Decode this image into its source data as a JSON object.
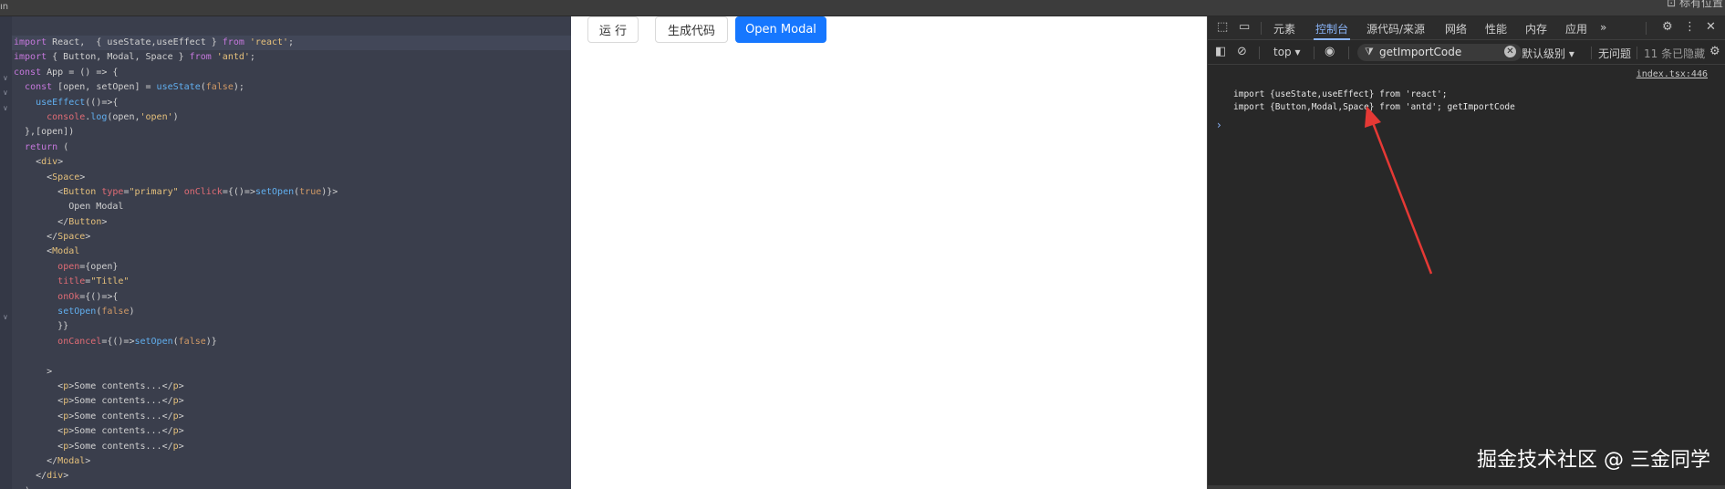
{
  "topbar": {
    "right_label": "⊡ 标有位置",
    "left_mark": "ın"
  },
  "editor": {
    "lines": [
      [
        [
          "kw",
          "import"
        ],
        [
          "plain",
          " React,  { useState,useEffect } "
        ],
        [
          "kw",
          "from"
        ],
        [
          "str",
          " 'react'"
        ],
        [
          "plain",
          ";"
        ]
      ],
      [
        [
          "kw",
          "import"
        ],
        [
          "plain",
          " { Button, Modal, Space } "
        ],
        [
          "kw",
          "from"
        ],
        [
          "str",
          " 'antd'"
        ],
        [
          "plain",
          ";"
        ]
      ],
      [
        [
          "kw",
          "const"
        ],
        [
          "plain",
          " App = () => {"
        ]
      ],
      [
        [
          "plain",
          "  "
        ],
        [
          "kw",
          "const"
        ],
        [
          "plain",
          " [open, setOpen] = "
        ],
        [
          "fn",
          "useState"
        ],
        [
          "plain",
          "("
        ],
        [
          "bool",
          "false"
        ],
        [
          "plain",
          ");"
        ]
      ],
      [
        [
          "plain",
          "    "
        ],
        [
          "fn",
          "useEffect"
        ],
        [
          "plain",
          "(()=>{"
        ]
      ],
      [
        [
          "plain",
          "      "
        ],
        [
          "attr",
          "console"
        ],
        [
          "plain",
          "."
        ],
        [
          "fn",
          "log"
        ],
        [
          "plain",
          "(open,"
        ],
        [
          "str",
          "'open'"
        ],
        [
          "plain",
          ")"
        ]
      ],
      [
        [
          "plain",
          "  },[open])"
        ]
      ],
      [
        [
          "plain",
          "  "
        ],
        [
          "kw",
          "return"
        ],
        [
          "plain",
          " ("
        ]
      ],
      [
        [
          "plain",
          "    <"
        ],
        [
          "tag",
          "div"
        ],
        [
          "plain",
          ">"
        ]
      ],
      [
        [
          "plain",
          "      <"
        ],
        [
          "tag",
          "Space"
        ],
        [
          "plain",
          ">"
        ]
      ],
      [
        [
          "plain",
          "        <"
        ],
        [
          "tag",
          "Button"
        ],
        [
          "plain",
          " "
        ],
        [
          "attr",
          "type"
        ],
        [
          "plain",
          "="
        ],
        [
          "str",
          "\"primary\""
        ],
        [
          "plain",
          " "
        ],
        [
          "attr",
          "onClick"
        ],
        [
          "plain",
          "={()=>"
        ],
        [
          "fn",
          "setOpen"
        ],
        [
          "plain",
          "("
        ],
        [
          "bool",
          "true"
        ],
        [
          "plain",
          ")}>"
        ]
      ],
      [
        [
          "plain",
          "          Open Modal"
        ]
      ],
      [
        [
          "plain",
          "        </"
        ],
        [
          "tag",
          "Button"
        ],
        [
          "plain",
          ">"
        ]
      ],
      [
        [
          "plain",
          "      </"
        ],
        [
          "tag",
          "Space"
        ],
        [
          "plain",
          ">"
        ]
      ],
      [
        [
          "plain",
          "      <"
        ],
        [
          "tag",
          "Modal"
        ]
      ],
      [
        [
          "plain",
          "        "
        ],
        [
          "attr",
          "open"
        ],
        [
          "plain",
          "={open}"
        ]
      ],
      [
        [
          "plain",
          "        "
        ],
        [
          "attr",
          "title"
        ],
        [
          "plain",
          "="
        ],
        [
          "str",
          "\"Title\""
        ]
      ],
      [
        [
          "plain",
          "        "
        ],
        [
          "attr",
          "onOk"
        ],
        [
          "plain",
          "={()=>{"
        ]
      ],
      [
        [
          "plain",
          "        "
        ],
        [
          "fn",
          "setOpen"
        ],
        [
          "plain",
          "("
        ],
        [
          "bool",
          "false"
        ],
        [
          "plain",
          ")"
        ]
      ],
      [
        [
          "plain",
          "        }}"
        ]
      ],
      [
        [
          "plain",
          "        "
        ],
        [
          "attr",
          "onCancel"
        ],
        [
          "plain",
          "={()=>"
        ],
        [
          "fn",
          "setOpen"
        ],
        [
          "plain",
          "("
        ],
        [
          "bool",
          "false"
        ],
        [
          "plain",
          ")}"
        ]
      ],
      [
        [
          "plain",
          ""
        ]
      ],
      [
        [
          "plain",
          "      >"
        ]
      ],
      [
        [
          "plain",
          "        <"
        ],
        [
          "tag",
          "p"
        ],
        [
          "plain",
          ">Some contents...</"
        ],
        [
          "tag",
          "p"
        ],
        [
          "plain",
          ">"
        ]
      ],
      [
        [
          "plain",
          "        <"
        ],
        [
          "tag",
          "p"
        ],
        [
          "plain",
          ">Some contents...</"
        ],
        [
          "tag",
          "p"
        ],
        [
          "plain",
          ">"
        ]
      ],
      [
        [
          "plain",
          "        <"
        ],
        [
          "tag",
          "p"
        ],
        [
          "plain",
          ">Some contents...</"
        ],
        [
          "tag",
          "p"
        ],
        [
          "plain",
          ">"
        ]
      ],
      [
        [
          "plain",
          "        <"
        ],
        [
          "tag",
          "p"
        ],
        [
          "plain",
          ">Some contents...</"
        ],
        [
          "tag",
          "p"
        ],
        [
          "plain",
          ">"
        ]
      ],
      [
        [
          "plain",
          "        <"
        ],
        [
          "tag",
          "p"
        ],
        [
          "plain",
          ">Some contents...</"
        ],
        [
          "tag",
          "p"
        ],
        [
          "plain",
          ">"
        ]
      ],
      [
        [
          "plain",
          "      </"
        ],
        [
          "tag",
          "Modal"
        ],
        [
          "plain",
          ">"
        ]
      ],
      [
        [
          "plain",
          "    </"
        ],
        [
          "tag",
          "div"
        ],
        [
          "plain",
          ">"
        ]
      ],
      [
        [
          "plain",
          "  );"
        ]
      ]
    ]
  },
  "preview": {
    "run_label": "运 行",
    "generate_label": "生成代码",
    "open_modal_label": "Open Modal"
  },
  "devtools": {
    "tabs": [
      "元素",
      "控制台",
      "源代码/来源",
      "网络",
      "性能",
      "内存",
      "应用"
    ],
    "active_tab": "控制台",
    "more_icon": "»",
    "context_select": "top ▾",
    "filter_value": "getImportCode",
    "level_select": "默认级别 ▾",
    "issues_label": "无问题",
    "hidden_count": "11 条已隐藏",
    "source_link": "index.tsx:446",
    "log_lines": [
      "import {useState,useEffect} from 'react';",
      "import {Button,Modal,Space} from 'antd'; getImportCode"
    ],
    "prompt": "›"
  },
  "watermark": "掘金技术社区 @ 三金同学",
  "colors": {
    "accent": "#1677ff",
    "devtools_active": "#8ab4f8",
    "arrow": "#e53935"
  }
}
